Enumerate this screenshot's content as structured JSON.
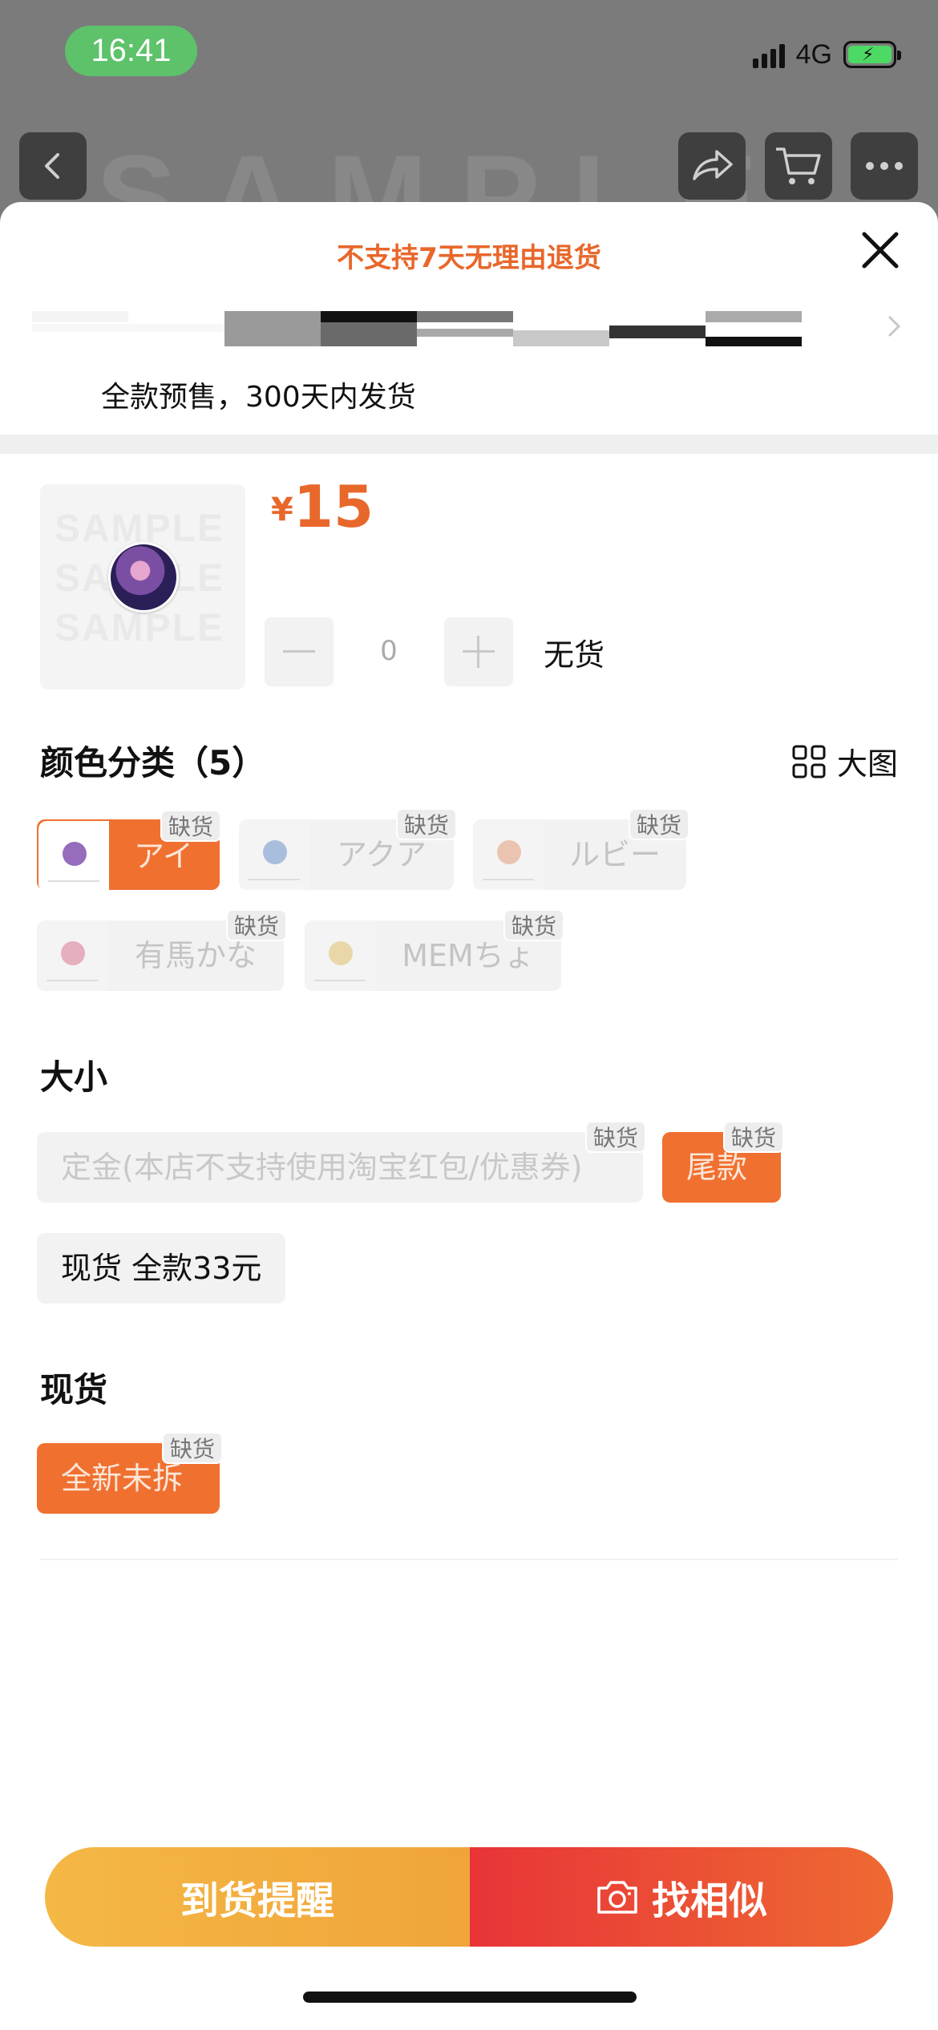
{
  "status_bar": {
    "time": "16:41",
    "network": "4G"
  },
  "background": {
    "watermark": "SAMPLE"
  },
  "sheet": {
    "title": "不支持7天无理由退货",
    "presale_note": "全款预售，300天内发货"
  },
  "product": {
    "currency": "¥",
    "price": "15",
    "thumb_watermark": "SAMPLE",
    "quantity": "0",
    "stock_status": "无货"
  },
  "color_section": {
    "title": "颜色分类（5）",
    "big_view_label": "大图",
    "options": [
      {
        "label": "アイ",
        "tag": "缺货",
        "selected": true,
        "dot_color": "#8a5db5"
      },
      {
        "label": "アクア",
        "tag": "缺货",
        "selected": false,
        "dot_color": "#6b8fc9"
      },
      {
        "label": "ルビー",
        "tag": "缺货",
        "selected": false,
        "dot_color": "#e49a7a"
      },
      {
        "label": "有馬かな",
        "tag": "缺货",
        "selected": false,
        "dot_color": "#d9768f"
      },
      {
        "label": "MEMちょ",
        "tag": "缺货",
        "selected": false,
        "dot_color": "#e2c06a"
      }
    ]
  },
  "size_section": {
    "title": "大小",
    "options": [
      {
        "label": "定金(本店不支持使用淘宝红包/优惠券)",
        "tag": "缺货"
      },
      {
        "label": "尾款",
        "tag": "缺货"
      },
      {
        "label": "现货 全款33元"
      }
    ]
  },
  "stock_section": {
    "title": "现货",
    "options": [
      {
        "label": "全新未拆",
        "tag": "缺货"
      }
    ]
  },
  "actions": {
    "notify_label": "到货提醒",
    "similar_label": "找相似"
  }
}
